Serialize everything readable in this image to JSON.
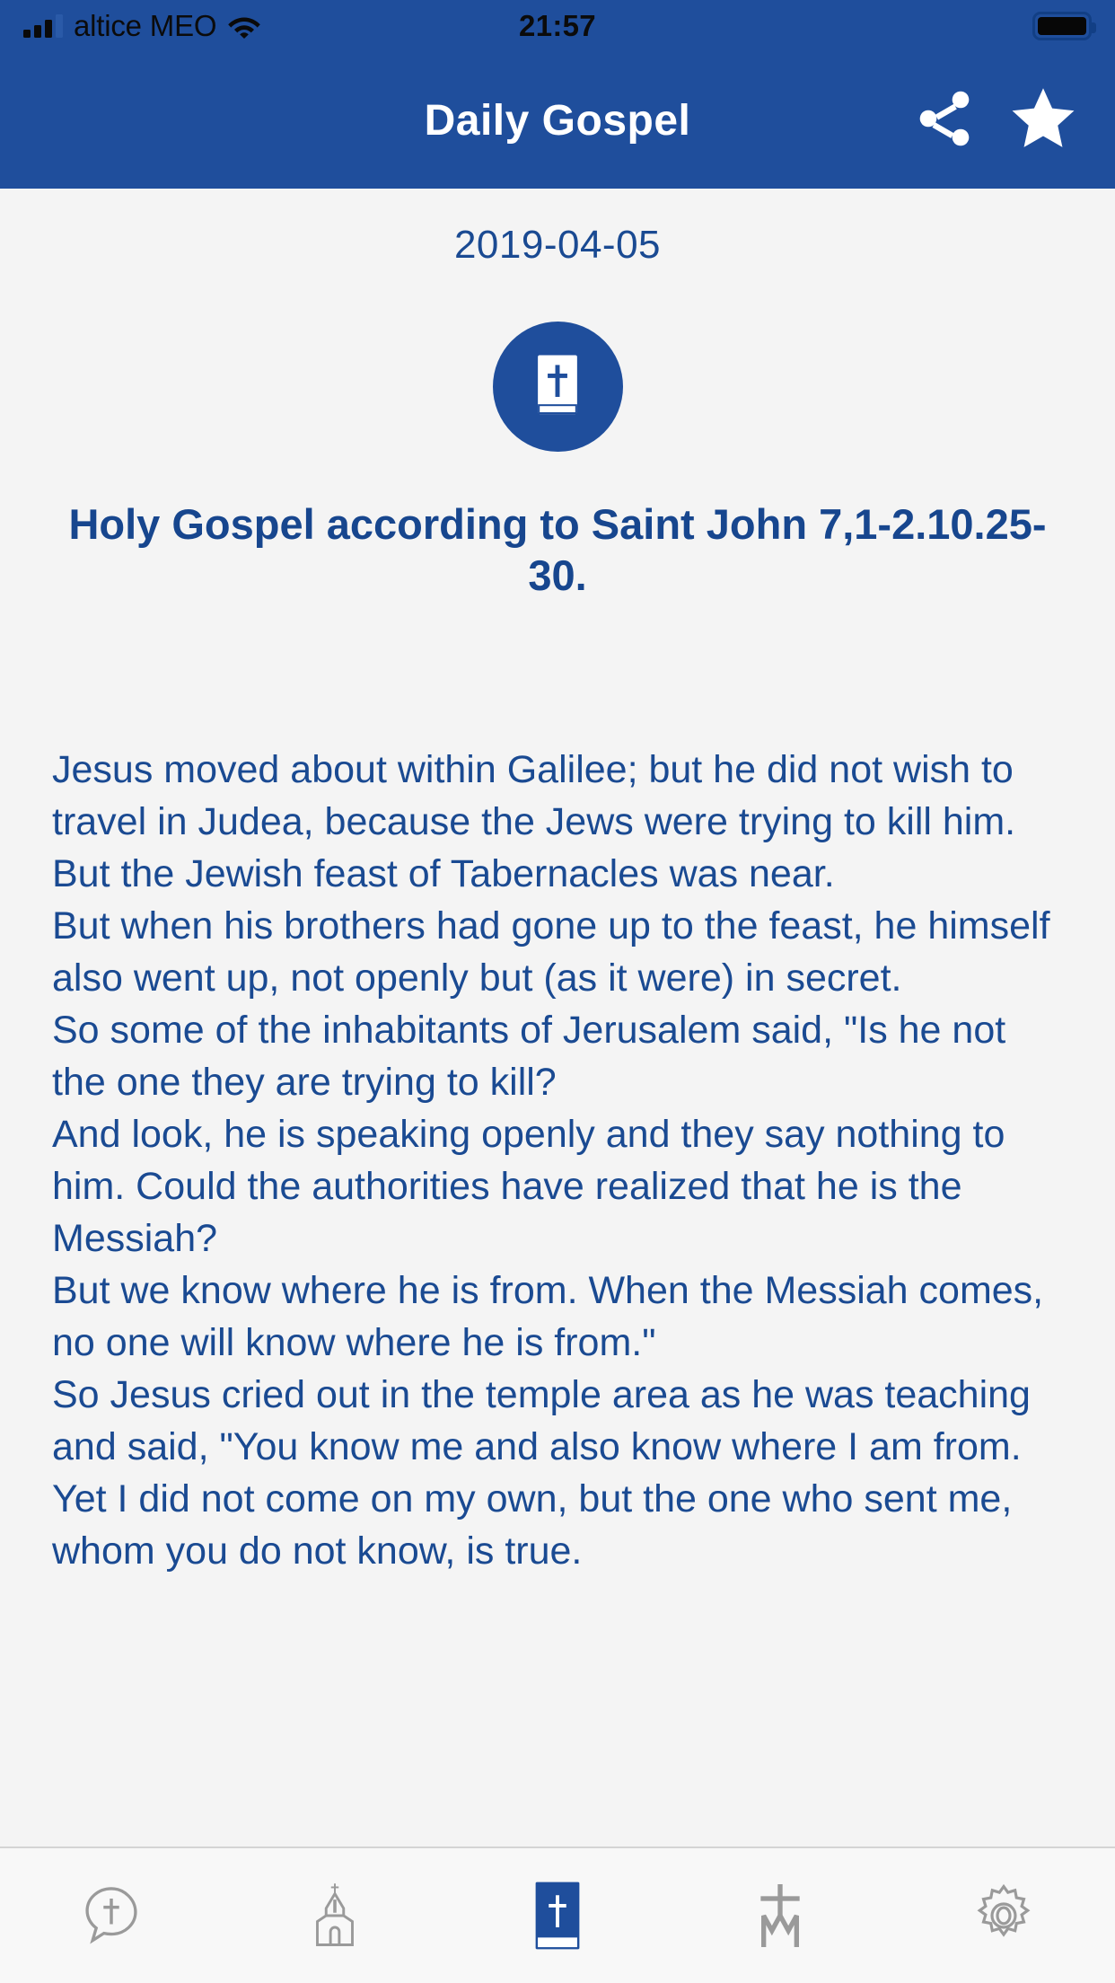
{
  "status_bar": {
    "carrier": "altice MEO",
    "time": "21:57",
    "signal_icon": "signal-bars-icon",
    "wifi_icon": "wifi-icon",
    "battery_icon": "battery-full-icon",
    "battery_level": "100"
  },
  "app_bar": {
    "title": "Daily Gospel",
    "share_icon": "share-icon",
    "favorite_icon": "star-icon"
  },
  "reading": {
    "date": "2019-04-05",
    "emblem_icon": "bible-cross-icon",
    "gospel_title": "Holy Gospel according to Saint John 7,1-2.10.25-30.",
    "passage": "Jesus moved about within Galilee; but he did not wish to travel in Judea, because the Jews were trying to kill him.\nBut the Jewish feast of Tabernacles was near.\nBut when his brothers had gone up to the feast, he himself also went up, not openly but (as it were) in secret.\nSo some of the inhabitants of Jerusalem said, \"Is he not the one they are trying to kill?\nAnd look, he is speaking openly and they say nothing to him. Could the authorities have realized that he is the Messiah?\nBut we know where he is from. When the Messiah comes, no one will know where he is from.\"\nSo Jesus cried out in the temple area as he was teaching and said, \"You know me and also know where I am from. Yet I did not come on my own, but the one who sent me, whom you do not know, is true."
  },
  "tab_bar": {
    "items": [
      {
        "name": "tab-prayer",
        "icon": "speech-bubble-cross-icon",
        "active": false
      },
      {
        "name": "tab-church",
        "icon": "church-icon",
        "active": false
      },
      {
        "name": "tab-gospel",
        "icon": "bible-cross-icon",
        "active": true
      },
      {
        "name": "tab-saints",
        "icon": "marian-cross-icon",
        "active": false
      },
      {
        "name": "tab-settings",
        "icon": "gear-icon",
        "active": false
      }
    ]
  },
  "colors": {
    "brand_blue": "#1f4e9c",
    "text_blue": "#1a4a92",
    "title_blue": "#17468e",
    "page_background": "#f4f4f4",
    "tabbar_background": "#f8f8f8",
    "tab_inactive": "#9a9a9a"
  }
}
